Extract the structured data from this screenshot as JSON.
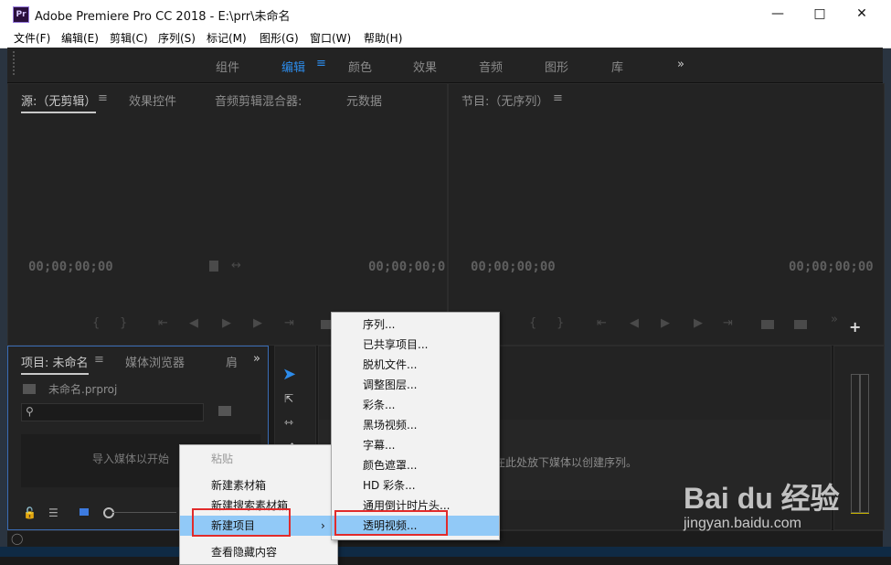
{
  "window": {
    "app_icon": "Pr",
    "title": "Adobe Premiere Pro CC 2018 - E:\\prr\\未命名",
    "min_icon": "minimize-icon",
    "max_icon": "maximize-icon",
    "close_icon": "close-icon"
  },
  "menubar": [
    "文件(F)",
    "编辑(E)",
    "剪辑(C)",
    "序列(S)",
    "标记(M)",
    "图形(G)",
    "窗口(W)",
    "帮助(H)"
  ],
  "workspaces": {
    "tabs": [
      "组件",
      "编辑",
      "颜色",
      "效果",
      "音频",
      "图形",
      "库"
    ],
    "active": "编辑",
    "more": "»"
  },
  "source_panel": {
    "tabs": [
      "源:（无剪辑）",
      "效果控件",
      "音频剪辑混合器:",
      "元数据"
    ],
    "tc_left": "00;00;00;00",
    "tc_right": "00;00;00;0"
  },
  "program_panel": {
    "tab": "节目:（无序列）",
    "tc_left": "00;00;00;00",
    "tc_right": "00;00;00;00"
  },
  "project_panel": {
    "tabs": [
      "项目: 未命名",
      "媒体浏览器",
      "肩"
    ],
    "file": "未命名.prproj",
    "hint": "导入媒体以开始"
  },
  "timeline": {
    "hint": "在此处放下媒体以创建序列。"
  },
  "context_menu_left": {
    "items": [
      "粘贴",
      "新建素材箱",
      "新建搜索素材箱",
      "新建项目",
      "查看隐藏内容"
    ],
    "highlighted": "新建项目",
    "submenu_arrow": "›"
  },
  "context_menu_right": {
    "items": [
      "序列...",
      "已共享项目...",
      "脱机文件...",
      "调整图层...",
      "彩条...",
      "黑场视频...",
      "字幕...",
      "颜色遮罩...",
      "HD 彩条...",
      "通用倒计时片头...",
      "透明视频..."
    ],
    "highlighted": "透明视频..."
  },
  "watermark": {
    "brand": "Bai du 经验",
    "url": "jingyan.baidu.com"
  },
  "colors": {
    "accent": "#2d8ceb",
    "highlight": "#91c9f7",
    "annotation": "#e12b2b"
  }
}
